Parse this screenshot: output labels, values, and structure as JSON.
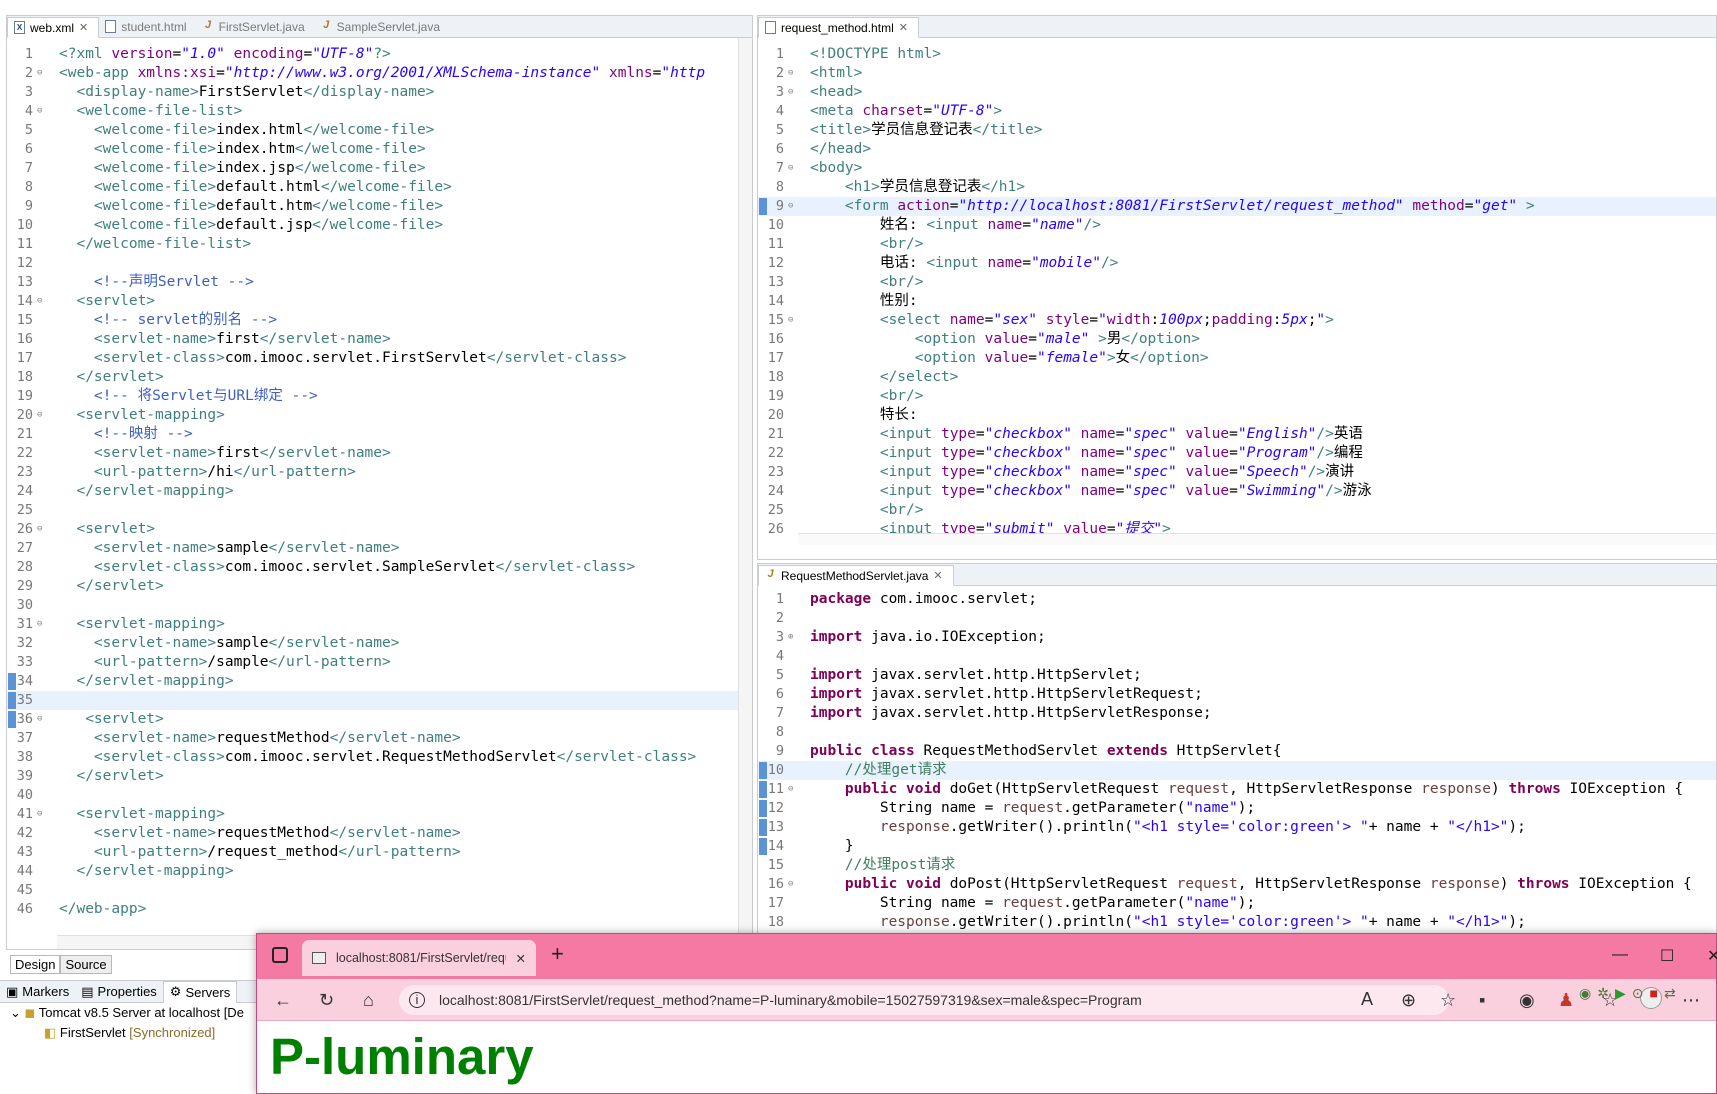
{
  "left_editor": {
    "tabs": [
      "web.xml",
      "student.html",
      "FirstServlet.java",
      "SampleServlet.java"
    ],
    "design_tab": "Design",
    "source_tab": "Source"
  },
  "right_top_editor": {
    "tabs": [
      "request_method.html"
    ]
  },
  "right_bottom_editor": {
    "tabs": [
      "RequestMethodServlet.java"
    ]
  },
  "bottom_panel": {
    "tabs": [
      "Markers",
      "Properties",
      "Servers"
    ],
    "server": "Tomcat v8.5 Server at localhost  [De",
    "project": "FirstServlet",
    "project_status": "[Synchronized]"
  },
  "browser": {
    "tab_title": "localhost:8081/FirstServlet/reque",
    "url": "localhost:8081/FirstServlet/request_method?name=P-luminary&mobile=15027597319&sex=male&spec=Program",
    "heading": "P-luminary"
  }
}
